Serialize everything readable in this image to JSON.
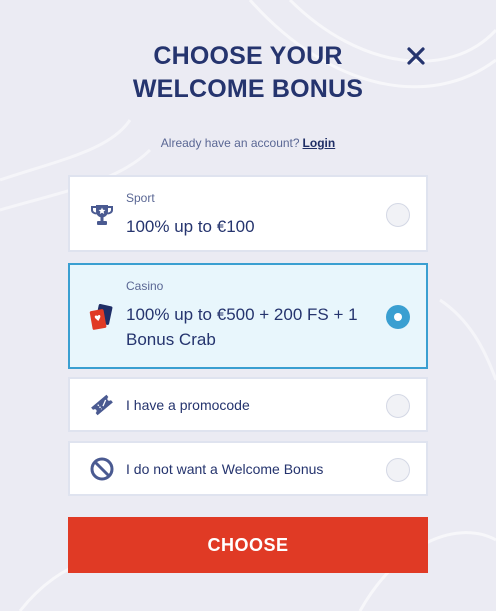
{
  "modal": {
    "title": "CHOOSE YOUR WELCOME BONUS",
    "account_prompt": "Already have an account?",
    "login_label": "Login"
  },
  "options": [
    {
      "category": "Sport",
      "title": "100% up to €100",
      "icon": "trophy-icon",
      "selected": false
    },
    {
      "category": "Casino",
      "title": "100% up to €500 + 200 FS + 1 Bonus Crab",
      "icon": "playing-cards-icon",
      "selected": true
    },
    {
      "label": "I have a promocode",
      "icon": "ticket-icon",
      "selected": false
    },
    {
      "label": "I do not want a Welcome Bonus",
      "icon": "no-entry-icon",
      "selected": false
    }
  ],
  "choose_label": "CHOOSE",
  "colors": {
    "background": "#ebebf3",
    "title": "#25346e",
    "accent_selected": "#3a9fd1",
    "selected_bg": "#e8f6fc",
    "button": "#e03a25"
  }
}
